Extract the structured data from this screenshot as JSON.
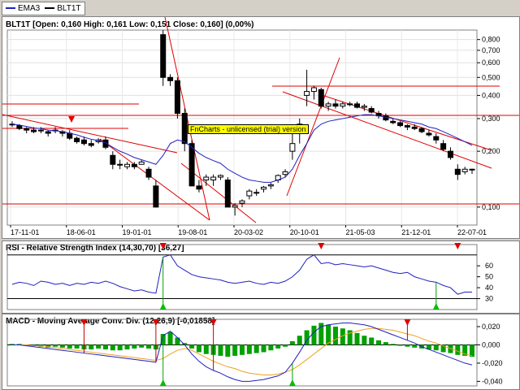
{
  "legend": {
    "items": [
      {
        "label": "EMA3",
        "color": "#2020c0"
      },
      {
        "label": "BLT1T",
        "color": "#000000"
      }
    ]
  },
  "price": {
    "title": "BLT1T [Open: 0,160  High: 0,161  Low: 0,151  Close: 0,160] (0,00%)",
    "yticks": [
      "0,800",
      "0,700",
      "0,600",
      "0,500",
      "0,400",
      "0,300",
      "0,200",
      "0,100"
    ],
    "xticks": [
      "17-11-01",
      "18-06-01",
      "19-01-01",
      "19-08-01",
      "20-03-02",
      "20-10-01",
      "21-05-03",
      "21-12-01",
      "22-07-01"
    ],
    "watermark": "FnCharts - unlicensed (trial) version"
  },
  "rsi": {
    "title": "RSI - Relative Strength Index (14,30,70) [36,27]",
    "yticks": [
      "60",
      "50",
      "40",
      "30"
    ]
  },
  "macd": {
    "title": "MACD - Moving Average Conv. Div. (12,26,9) [-0,01858]",
    "yticks": [
      "0,020",
      "0,000",
      "-0,020",
      "-0,040"
    ]
  },
  "chart_data": [
    {
      "type": "candlestick",
      "name": "BLT1T",
      "ylim": [
        0.08,
        0.9
      ],
      "log_scale": true,
      "x": [
        "17-11-01",
        "18-06-01",
        "19-01-01",
        "19-08-01",
        "20-03-02",
        "20-10-01",
        "21-05-03",
        "21-12-01",
        "22-07-01"
      ],
      "candles": [
        [
          0.28,
          0.29,
          0.27,
          0.28
        ],
        [
          0.275,
          0.28,
          0.26,
          0.265
        ],
        [
          0.265,
          0.27,
          0.25,
          0.26
        ],
        [
          0.26,
          0.27,
          0.25,
          0.255
        ],
        [
          0.26,
          0.27,
          0.25,
          0.26
        ],
        [
          0.255,
          0.26,
          0.24,
          0.25
        ],
        [
          0.26,
          0.27,
          0.25,
          0.26
        ],
        [
          0.255,
          0.26,
          0.24,
          0.25
        ],
        [
          0.25,
          0.26,
          0.23,
          0.235
        ],
        [
          0.235,
          0.24,
          0.22,
          0.225
        ],
        [
          0.23,
          0.24,
          0.215,
          0.22
        ],
        [
          0.22,
          0.23,
          0.21,
          0.215
        ],
        [
          0.225,
          0.235,
          0.22,
          0.23
        ],
        [
          0.23,
          0.24,
          0.205,
          0.21
        ],
        [
          0.19,
          0.2,
          0.16,
          0.17
        ],
        [
          0.17,
          0.18,
          0.16,
          0.17
        ],
        [
          0.165,
          0.175,
          0.16,
          0.17
        ],
        [
          0.17,
          0.175,
          0.16,
          0.165
        ],
        [
          0.17,
          0.18,
          0.17,
          0.175
        ],
        [
          0.16,
          0.165,
          0.14,
          0.145
        ],
        [
          0.13,
          0.14,
          0.1,
          0.1
        ],
        [
          0.85,
          0.9,
          0.45,
          0.5
        ],
        [
          0.5,
          0.52,
          0.45,
          0.48
        ],
        [
          0.48,
          0.5,
          0.3,
          0.32
        ],
        [
          0.32,
          0.34,
          0.2,
          0.22
        ],
        [
          0.22,
          0.23,
          0.13,
          0.13
        ],
        [
          0.13,
          0.14,
          0.12,
          0.125
        ],
        [
          0.14,
          0.15,
          0.13,
          0.145
        ],
        [
          0.14,
          0.15,
          0.13,
          0.145
        ],
        [
          0.145,
          0.15,
          0.14,
          0.148
        ],
        [
          0.14,
          0.145,
          0.1,
          0.1
        ],
        [
          0.1,
          0.105,
          0.09,
          0.102
        ],
        [
          0.105,
          0.11,
          0.1,
          0.108
        ],
        [
          0.115,
          0.125,
          0.11,
          0.122
        ],
        [
          0.12,
          0.125,
          0.115,
          0.12
        ],
        [
          0.125,
          0.13,
          0.12,
          0.128
        ],
        [
          0.13,
          0.135,
          0.125,
          0.132
        ],
        [
          0.14,
          0.15,
          0.135,
          0.148
        ],
        [
          0.15,
          0.16,
          0.145,
          0.155
        ],
        [
          0.2,
          0.25,
          0.18,
          0.22
        ],
        [
          0.25,
          0.3,
          0.22,
          0.28
        ],
        [
          0.4,
          0.55,
          0.35,
          0.42
        ],
        [
          0.42,
          0.45,
          0.38,
          0.44
        ],
        [
          0.43,
          0.44,
          0.34,
          0.35
        ],
        [
          0.35,
          0.37,
          0.33,
          0.36
        ],
        [
          0.36,
          0.38,
          0.34,
          0.35
        ],
        [
          0.35,
          0.37,
          0.34,
          0.36
        ],
        [
          0.36,
          0.37,
          0.35,
          0.36
        ],
        [
          0.36,
          0.37,
          0.34,
          0.345
        ],
        [
          0.345,
          0.36,
          0.33,
          0.35
        ],
        [
          0.34,
          0.35,
          0.32,
          0.325
        ],
        [
          0.32,
          0.33,
          0.3,
          0.31
        ],
        [
          0.31,
          0.32,
          0.29,
          0.295
        ],
        [
          0.29,
          0.3,
          0.28,
          0.285
        ],
        [
          0.285,
          0.29,
          0.27,
          0.275
        ],
        [
          0.275,
          0.28,
          0.26,
          0.27
        ],
        [
          0.27,
          0.28,
          0.26,
          0.265
        ],
        [
          0.265,
          0.27,
          0.25,
          0.255
        ],
        [
          0.25,
          0.26,
          0.24,
          0.245
        ],
        [
          0.24,
          0.25,
          0.22,
          0.23
        ],
        [
          0.22,
          0.23,
          0.2,
          0.205
        ],
        [
          0.2,
          0.21,
          0.18,
          0.185
        ],
        [
          0.16,
          0.17,
          0.14,
          0.15
        ],
        [
          0.155,
          0.165,
          0.15,
          0.16
        ],
        [
          0.16,
          0.161,
          0.151,
          0.16
        ]
      ],
      "ema": [
        0.28,
        0.277,
        0.272,
        0.267,
        0.265,
        0.26,
        0.258,
        0.255,
        0.25,
        0.245,
        0.238,
        0.232,
        0.228,
        0.222,
        0.21,
        0.2,
        0.193,
        0.185,
        0.18,
        0.175,
        0.17,
        0.19,
        0.22,
        0.23,
        0.225,
        0.21,
        0.195,
        0.185,
        0.178,
        0.172,
        0.16,
        0.152,
        0.145,
        0.14,
        0.138,
        0.136,
        0.136,
        0.14,
        0.145,
        0.16,
        0.19,
        0.22,
        0.26,
        0.28,
        0.29,
        0.295,
        0.3,
        0.305,
        0.31,
        0.315,
        0.315,
        0.31,
        0.305,
        0.3,
        0.295,
        0.29,
        0.285,
        0.28,
        0.27,
        0.265,
        0.255,
        0.245,
        0.235,
        0.225,
        0.215
      ]
    },
    {
      "type": "line",
      "name": "RSI",
      "ylim": [
        20,
        72
      ],
      "levels": [
        30,
        70
      ],
      "values": [
        43,
        45,
        44,
        42,
        46,
        45,
        43,
        44,
        42,
        44,
        43,
        45,
        44,
        46,
        44,
        41,
        39,
        37,
        38,
        36,
        35,
        68,
        70,
        60,
        56,
        52,
        50,
        49,
        48,
        47,
        45,
        44,
        45,
        46,
        44,
        43,
        45,
        44,
        46,
        50,
        56,
        66,
        70,
        62,
        63,
        61,
        62,
        61,
        60,
        59,
        60,
        58,
        56,
        54,
        53,
        54,
        50,
        48,
        46,
        45,
        42,
        40,
        34,
        36,
        36
      ],
      "up_arrows_at": [
        21,
        59
      ],
      "down_arrows_at": [
        21,
        43,
        62
      ]
    },
    {
      "type": "bar_line",
      "name": "MACD",
      "ylim": [
        -0.045,
        0.028
      ],
      "histogram": [
        0.001,
        0.001,
        0.0,
        -0.001,
        -0.002,
        -0.003,
        -0.002,
        -0.003,
        -0.004,
        -0.004,
        -0.005,
        -0.005,
        -0.004,
        -0.005,
        -0.006,
        -0.006,
        -0.005,
        -0.004,
        -0.003,
        -0.004,
        -0.005,
        0.012,
        0.014,
        0.008,
        0.002,
        -0.004,
        -0.008,
        -0.01,
        -0.011,
        -0.012,
        -0.013,
        -0.012,
        -0.011,
        -0.01,
        -0.009,
        -0.008,
        -0.006,
        -0.004,
        -0.002,
        0.004,
        0.01,
        0.016,
        0.021,
        0.024,
        0.022,
        0.02,
        0.018,
        0.016,
        0.013,
        0.01,
        0.008,
        0.005,
        0.003,
        0.001,
        -0.001,
        -0.002,
        -0.003,
        -0.004,
        -0.005,
        -0.006,
        -0.008,
        -0.009,
        -0.011,
        -0.012,
        -0.013
      ],
      "macd": [
        0.0,
        0.0,
        -0.001,
        -0.002,
        -0.003,
        -0.004,
        -0.005,
        -0.006,
        -0.007,
        -0.008,
        -0.009,
        -0.01,
        -0.011,
        -0.012,
        -0.013,
        -0.014,
        -0.015,
        -0.016,
        -0.017,
        -0.018,
        -0.019,
        0.01,
        0.015,
        0.008,
        0.0,
        -0.01,
        -0.018,
        -0.024,
        -0.028,
        -0.031,
        -0.035,
        -0.038,
        -0.04,
        -0.04,
        -0.039,
        -0.038,
        -0.036,
        -0.034,
        -0.03,
        -0.02,
        -0.008,
        0.005,
        0.014,
        0.02,
        0.022,
        0.023,
        0.024,
        0.024,
        0.023,
        0.022,
        0.02,
        0.017,
        0.014,
        0.011,
        0.008,
        0.005,
        0.002,
        -0.002,
        -0.005,
        -0.008,
        -0.011,
        -0.014,
        -0.017,
        -0.02,
        -0.022
      ],
      "signal": [
        0.0,
        0.0,
        0.0,
        -0.001,
        -0.001,
        -0.002,
        -0.003,
        -0.004,
        -0.005,
        -0.006,
        -0.007,
        -0.008,
        -0.009,
        -0.01,
        -0.011,
        -0.012,
        -0.013,
        -0.014,
        -0.015,
        -0.016,
        -0.017,
        -0.015,
        -0.01,
        -0.006,
        -0.004,
        -0.006,
        -0.01,
        -0.014,
        -0.018,
        -0.021,
        -0.024,
        -0.026,
        -0.029,
        -0.031,
        -0.032,
        -0.033,
        -0.033,
        -0.032,
        -0.03,
        -0.027,
        -0.022,
        -0.016,
        -0.01,
        -0.004,
        0.002,
        0.006,
        0.01,
        0.013,
        0.015,
        0.017,
        0.018,
        0.018,
        0.017,
        0.016,
        0.014,
        0.012,
        0.01,
        0.007,
        0.004,
        0.002,
        -0.001,
        -0.004,
        -0.007,
        -0.01,
        -0.012
      ],
      "up_arrows_at": [
        21,
        39
      ],
      "down_arrows_at": [
        10,
        20,
        28,
        55
      ]
    }
  ]
}
